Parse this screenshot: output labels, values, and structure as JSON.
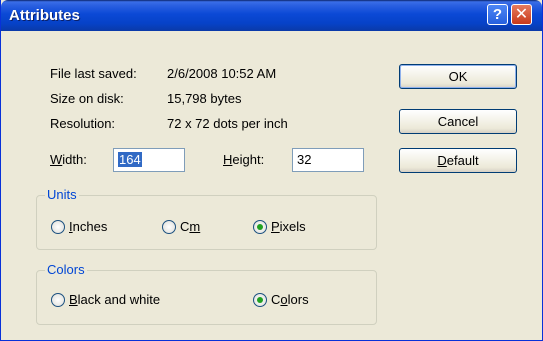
{
  "window": {
    "title": "Attributes",
    "help_glyph": "?",
    "close_glyph": "✕"
  },
  "info": [
    {
      "label": "File last saved:",
      "value": "2/6/2008 10:52 AM"
    },
    {
      "label": "Size on disk:",
      "value": "15,798 bytes"
    },
    {
      "label": "Resolution:",
      "value": "72 x 72 dots per inch"
    }
  ],
  "width": {
    "label_mnemonic": "W",
    "label_rest": "idth:",
    "value": "164"
  },
  "height": {
    "label_mnemonic": "H",
    "label_rest": "eight:",
    "value": "32"
  },
  "units": {
    "legend": "Units",
    "options": [
      {
        "mnemonic": "I",
        "rest": "nches",
        "checked": false
      },
      {
        "pre": "C",
        "mnemonic": "m",
        "rest": "",
        "checked": false
      },
      {
        "mnemonic": "P",
        "rest": "ixels",
        "checked": true
      }
    ]
  },
  "colors": {
    "legend": "Colors",
    "options": [
      {
        "mnemonic": "B",
        "rest": "lack and white",
        "checked": false
      },
      {
        "pre": "C",
        "mnemonic": "o",
        "rest": "lors",
        "checked": true
      }
    ]
  },
  "buttons": {
    "ok": "OK",
    "cancel": "Cancel",
    "default_mnemonic": "D",
    "default_rest": "efault"
  },
  "theme": {
    "title_bar": "#0b49d6",
    "dialog_bg": "#ece9d8",
    "legend_color": "#0046d5",
    "radio_dot": "#21a121"
  }
}
